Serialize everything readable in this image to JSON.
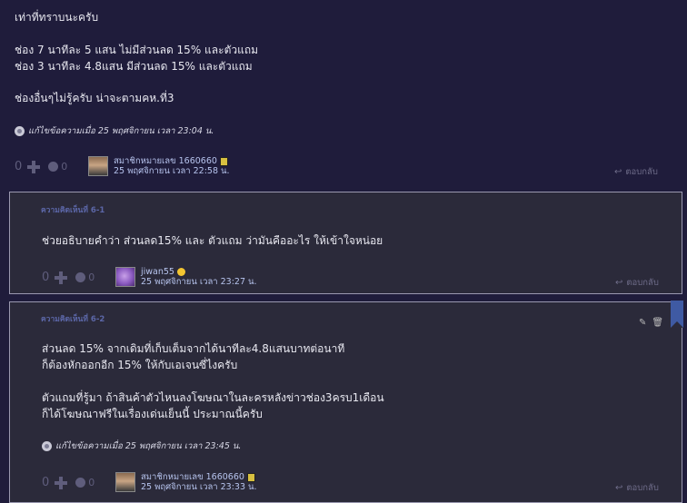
{
  "main_post": {
    "lines": [
      "เท่าที่ทราบนะครับ",
      "ช่อง 7 นาทีละ 5 แสน ไม่มีส่วนลด 15% และตัวแถม",
      "ช่อง 3 นาทีละ 4.8แสน มีส่วนลด 15% และตัวแถม",
      "ช่องอื่นๆไม่รู้ครับ น่าจะตามคห.ที่3"
    ],
    "edited": "แก้ไขข้อความเมื่อ 25 พฤศจิกายน เวลา 23:04 น.",
    "votes": "0",
    "emotions": "0",
    "author": "สมาชิกหมายเลข 1660660",
    "date": "25 พฤศจิกายน เวลา 22:58 น.",
    "reply_label": "ตอบกลับ"
  },
  "comment_1": {
    "label": "ความคิดเห็นที่ 6-1",
    "text": "ช่วยอธิบายคำว่า ส่วนลด15% และ ตัวแถม ว่ามันคืออะไร ให้เข้าใจหน่อย",
    "votes": "0",
    "emotions": "0",
    "author": "jiwan55",
    "date": "25 พฤศจิกายน เวลา 23:27 น.",
    "reply_label": "ตอบกลับ"
  },
  "comment_2": {
    "label": "ความคิดเห็นที่ 6-2",
    "lines": [
      "ส่วนลด 15% จากเดิมที่เก็บเต็มจากได้นาทีละ4.8แสนบาทต่อนาที",
      "ก็ต้องหักออกอีก 15% ให้กับเอเจนซี่ไงครับ",
      "ตัวแถมที่รู้มา ถ้าสินค้าตัวไหนลงโฆษณาในละครหลังข่าวช่อง3ครบ1เดือน",
      "ก็ได้โฆษณาฟรีในเรื่องเด่นเย็นนี้ ประมาณนี้ครับ"
    ],
    "edited": "แก้ไขข้อความเมื่อ 25 พฤศจิกายน เวลา 23:45 น.",
    "votes": "0",
    "emotions": "0",
    "author": "สมาชิกหมายเลข 1660660",
    "date": "25 พฤศจิกายน เวลา 23:33 น.",
    "reply_label": "ตอบกลับ"
  }
}
